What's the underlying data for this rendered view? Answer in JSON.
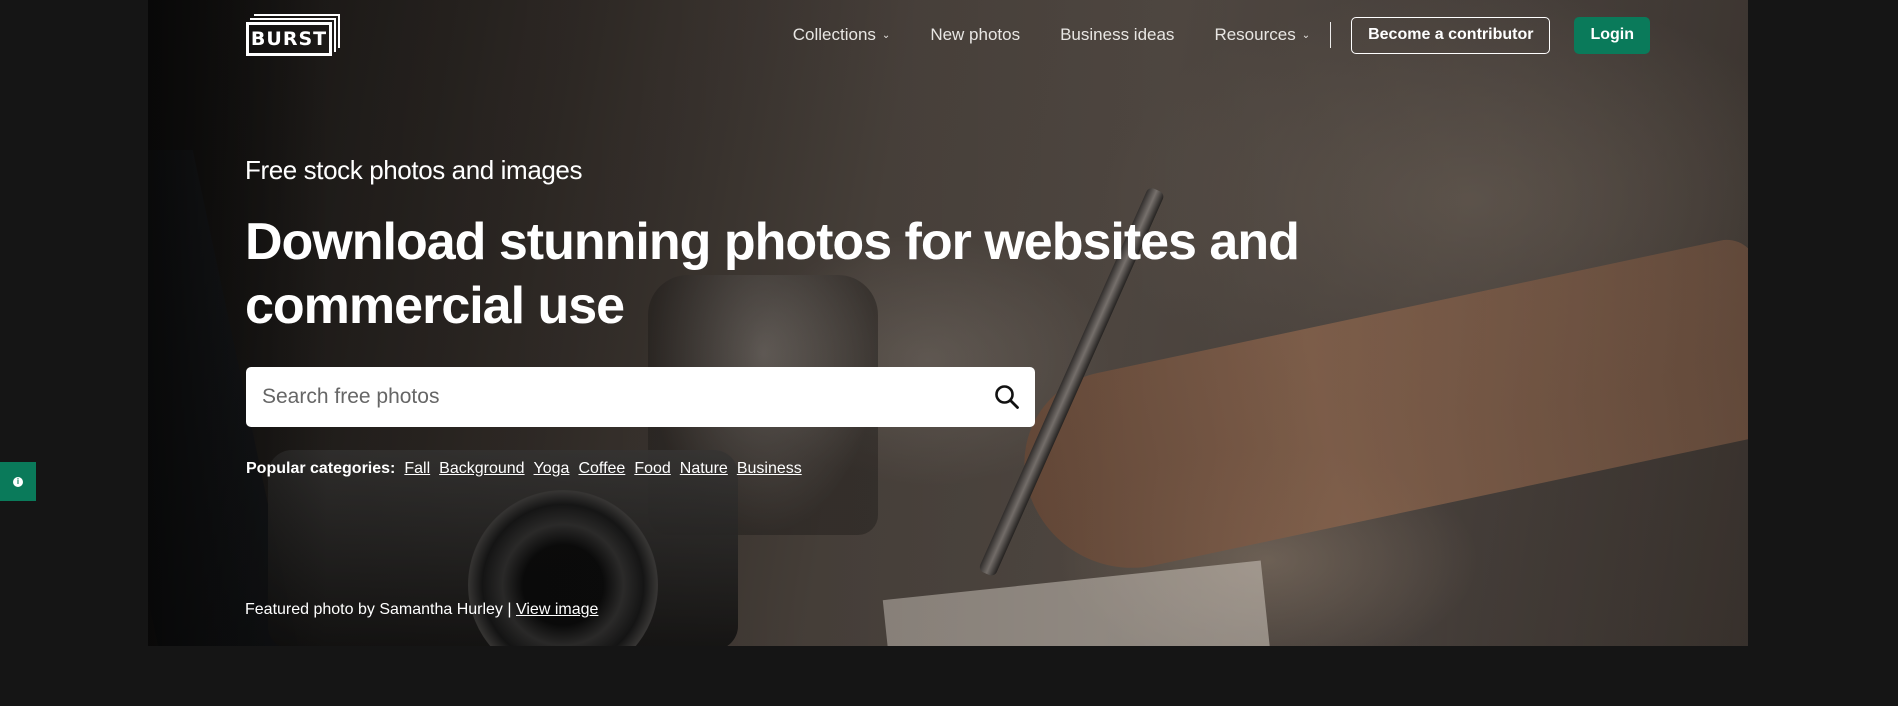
{
  "brand": {
    "logo_text": "BURST",
    "accent_color": "#0a7a5a"
  },
  "nav": {
    "items": [
      {
        "label": "Collections",
        "icon": "chevron-down-icon"
      },
      {
        "label": "New photos"
      },
      {
        "label": "Business ideas"
      },
      {
        "label": "Resources",
        "icon": "chevron-down-icon"
      }
    ],
    "contributor_label": "Become a contributor",
    "login_label": "Login"
  },
  "hero": {
    "subtitle": "Free stock photos and images",
    "headline": "Download stunning photos for websites and commercial use",
    "search": {
      "placeholder": "Search free photos",
      "icon": "search-icon"
    },
    "categories_label": "Popular categories:",
    "categories": [
      "Fall",
      "Background",
      "Yoga",
      "Coffee",
      "Food",
      "Nature",
      "Business"
    ],
    "credit_text": "Featured photo by Samantha Hurley |",
    "credit_link": "View image"
  },
  "side_tab": {
    "icon": "info-icon",
    "glyph": "i"
  }
}
